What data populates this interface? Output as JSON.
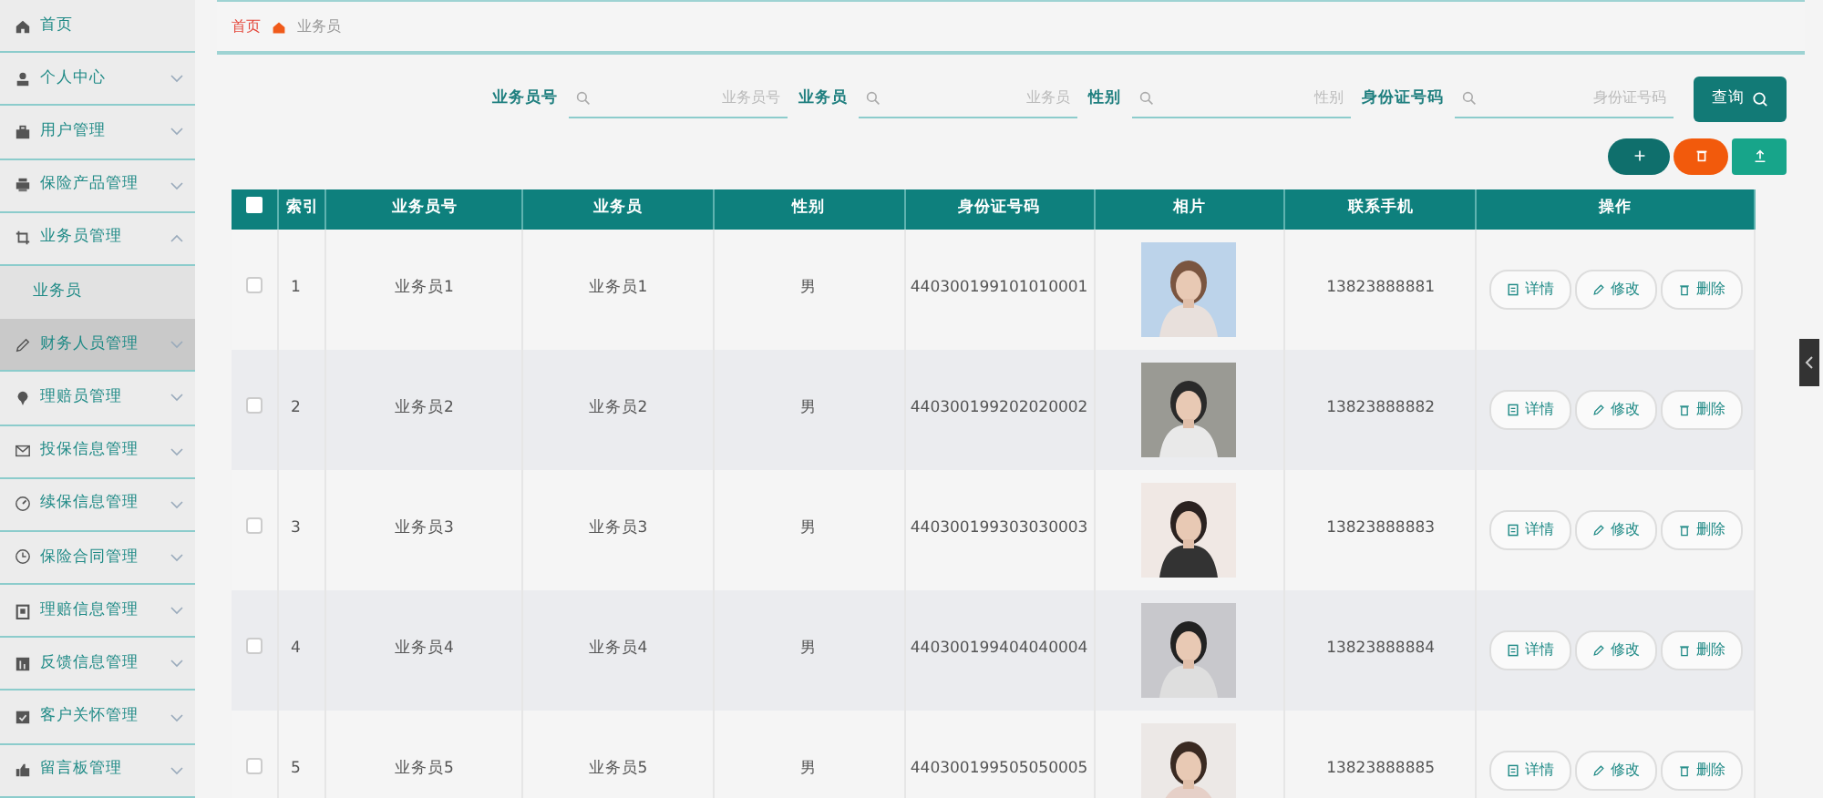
{
  "sidebar": {
    "items": [
      {
        "label": "首页",
        "kind": "link",
        "highlighted": false
      },
      {
        "label": "个人中心",
        "kind": "menu",
        "expanded": false,
        "highlighted": false
      },
      {
        "label": "用户管理",
        "kind": "menu",
        "expanded": false,
        "highlighted": false
      },
      {
        "label": "保险产品管理",
        "kind": "menu",
        "expanded": false,
        "highlighted": false
      },
      {
        "label": "业务员管理",
        "kind": "menu",
        "expanded": true,
        "highlighted": false,
        "children": [
          {
            "label": "业务员"
          }
        ]
      },
      {
        "label": "财务人员管理",
        "kind": "menu",
        "expanded": false,
        "highlighted": true
      },
      {
        "label": "理赔员管理",
        "kind": "menu",
        "expanded": false,
        "highlighted": false
      },
      {
        "label": "投保信息管理",
        "kind": "menu",
        "expanded": false,
        "highlighted": false
      },
      {
        "label": "续保信息管理",
        "kind": "menu",
        "expanded": false,
        "highlighted": false
      },
      {
        "label": "保险合同管理",
        "kind": "menu",
        "expanded": false,
        "highlighted": false
      },
      {
        "label": "理赔信息管理",
        "kind": "menu",
        "expanded": false,
        "highlighted": false
      },
      {
        "label": "反馈信息管理",
        "kind": "menu",
        "expanded": false,
        "highlighted": false
      },
      {
        "label": "客户关怀管理",
        "kind": "menu",
        "expanded": false,
        "highlighted": false
      },
      {
        "label": "留言板管理",
        "kind": "menu",
        "expanded": false,
        "highlighted": false
      }
    ]
  },
  "breadcrumb": [
    "首页",
    "业务员"
  ],
  "search": {
    "fields": [
      {
        "label": "业务员号",
        "placeholder": "业务员号"
      },
      {
        "label": "业务员",
        "placeholder": "业务员"
      },
      {
        "label": "性别",
        "placeholder": "性别"
      },
      {
        "label": "身份证号码",
        "placeholder": "身份证号码"
      }
    ],
    "button": "查询"
  },
  "table": {
    "select_all": {
      "checked": false
    },
    "columns": [
      "索引",
      "业务员号",
      "业务员",
      "性别",
      "身份证号码",
      "相片",
      "联系手机",
      "操作"
    ],
    "rows": [
      {
        "checked": false,
        "index": "1",
        "number": "业务员1",
        "name": "业务员1",
        "gender": "男",
        "id_number": "440300199101010001",
        "photo": {
          "kind": "picture"
        },
        "phone": "13823888881",
        "actions": [
          "详情",
          "修改",
          "删除"
        ]
      },
      {
        "checked": false,
        "index": "2",
        "number": "业务员2",
        "name": "业务员2",
        "gender": "男",
        "id_number": "440300199202020002",
        "photo": {
          "kind": "picture"
        },
        "phone": "13823888882",
        "actions": [
          "详情",
          "修改",
          "删除"
        ]
      },
      {
        "checked": false,
        "index": "3",
        "number": "业务员3",
        "name": "业务员3",
        "gender": "男",
        "id_number": "440300199303030003",
        "photo": {
          "kind": "picture"
        },
        "phone": "13823888883",
        "actions": [
          "详情",
          "修改",
          "删除"
        ]
      },
      {
        "checked": false,
        "index": "4",
        "number": "业务员4",
        "name": "业务员4",
        "gender": "男",
        "id_number": "440300199404040004",
        "photo": {
          "kind": "picture"
        },
        "phone": "13823888884",
        "actions": [
          "详情",
          "修改",
          "删除"
        ]
      },
      {
        "checked": false,
        "index": "5",
        "number": "业务员5",
        "name": "业务员5",
        "gender": "男",
        "id_number": "440300199505050005",
        "photo": {
          "kind": "picture"
        },
        "phone": "13823888885",
        "actions": [
          "详情",
          "修改",
          "删除"
        ]
      }
    ]
  }
}
